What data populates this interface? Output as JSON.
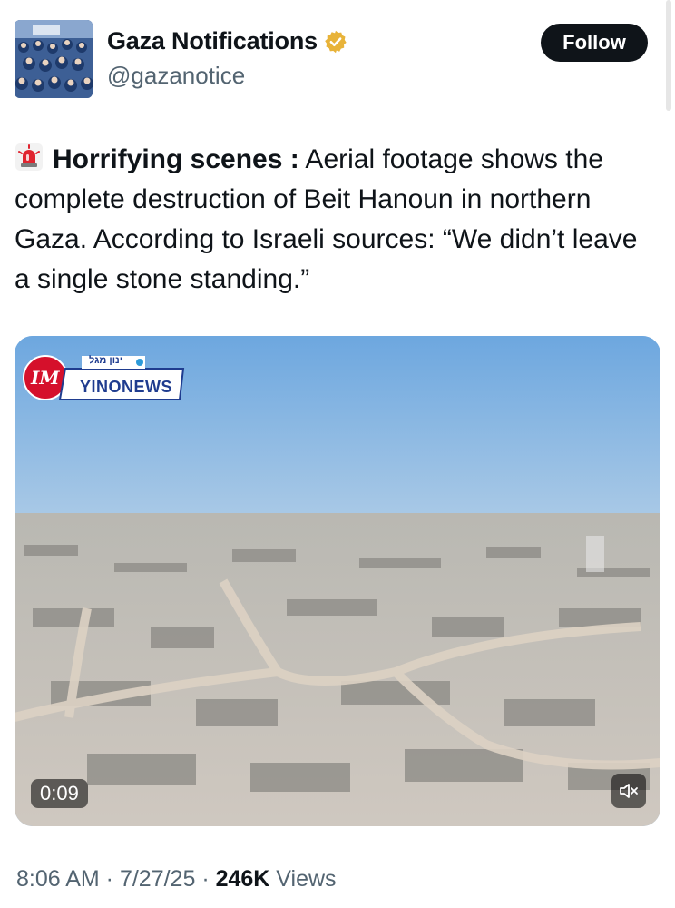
{
  "author": {
    "name": "Gaza Notifications",
    "handle": "@gazanotice",
    "follow_label": "Follow"
  },
  "tweet": {
    "headline": "Horrifying scenes :",
    "body": " Aerial footage shows the complete destruction of Beit Hanoun in northern Gaza. According to Israeli sources: “We didn’t leave a single stone standing.”"
  },
  "video": {
    "duration": "0:09",
    "watermark_brand": "YINONEWS",
    "watermark_mark": "IM",
    "watermark_hebrew": "ינון מגל"
  },
  "meta": {
    "time": "8:06 AM",
    "date": "7/27/25",
    "views_count": "246K",
    "views_label": " Views",
    "separator": " · "
  },
  "colors": {
    "verified_badge": "#e8b339",
    "follow_bg": "#0f1419",
    "secondary_text": "#536471"
  },
  "icons": [
    "verified-badge-icon",
    "siren-icon",
    "mute-icon"
  ]
}
